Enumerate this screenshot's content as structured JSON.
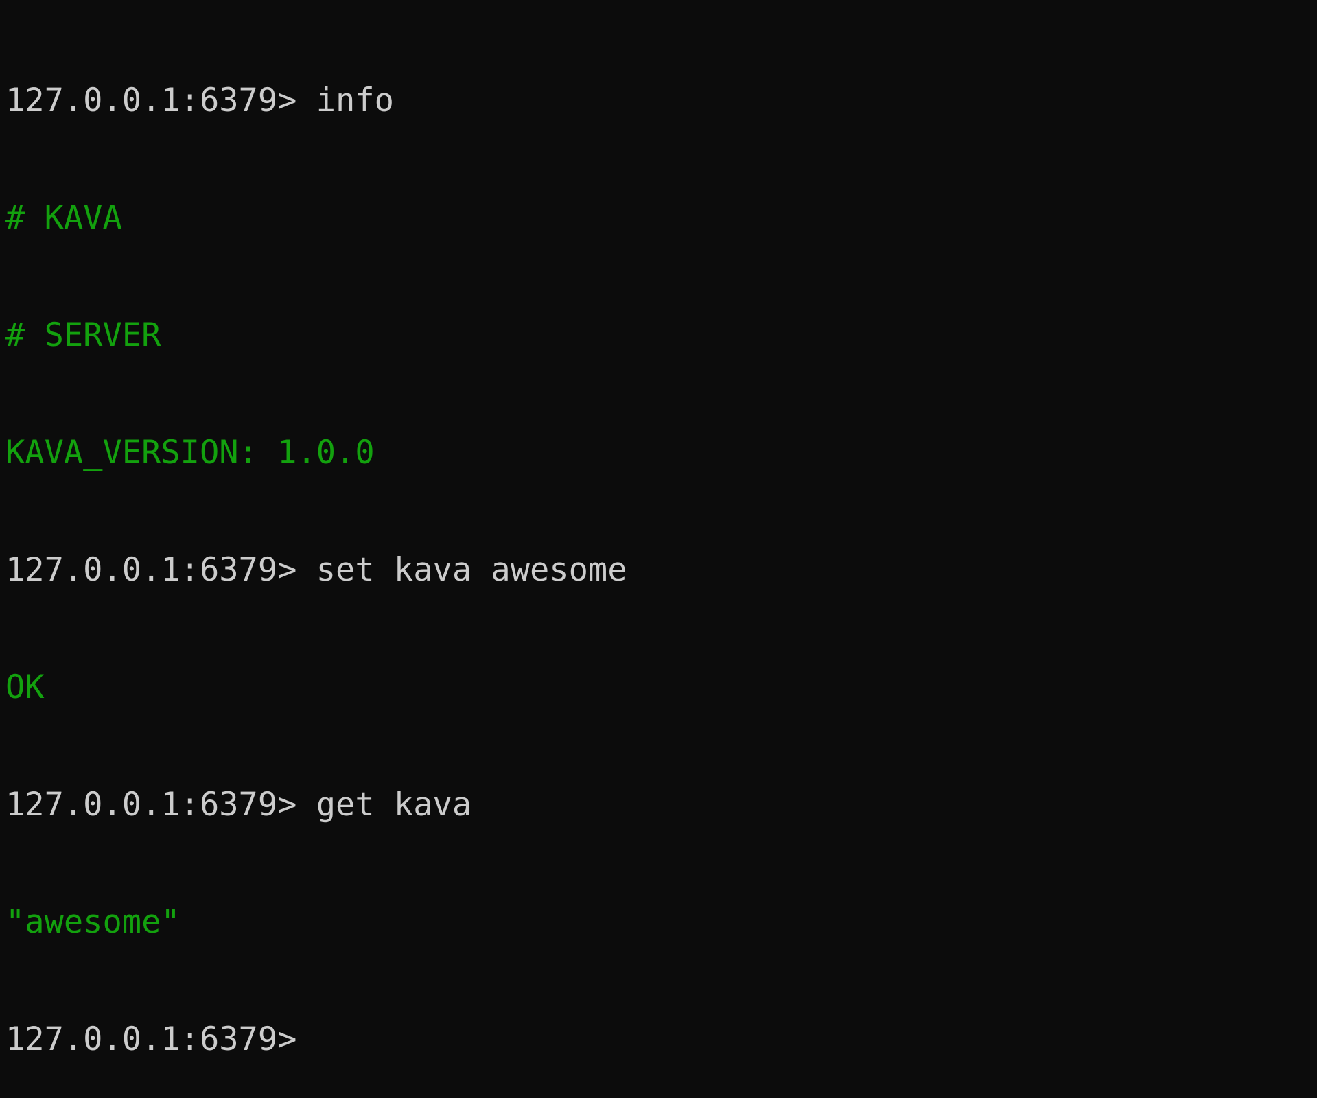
{
  "colors": {
    "background": "#0c0c0c",
    "foreground": "#cccccc",
    "output": "#13a10e"
  },
  "terminal": {
    "lines": [
      {
        "type": "command",
        "prompt": "127.0.0.1:6379>",
        "command": " info"
      },
      {
        "type": "output",
        "text": "# KAVA"
      },
      {
        "type": "output",
        "text": "# SERVER"
      },
      {
        "type": "output",
        "text": "KAVA_VERSION: 1.0.0"
      },
      {
        "type": "command",
        "prompt": "127.0.0.1:6379>",
        "command": " set kava awesome"
      },
      {
        "type": "output",
        "text": "OK"
      },
      {
        "type": "command",
        "prompt": "127.0.0.1:6379>",
        "command": " get kava"
      },
      {
        "type": "output",
        "text": "\"awesome\""
      },
      {
        "type": "command",
        "prompt": "127.0.0.1:6379>",
        "command": ""
      }
    ]
  }
}
